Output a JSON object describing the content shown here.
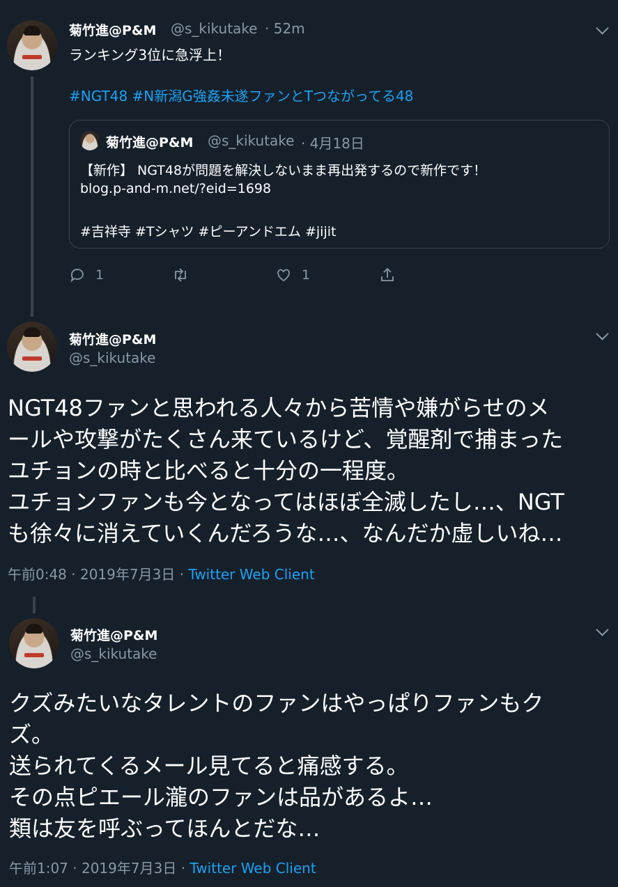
{
  "tweet1": {
    "author_name": "菊竹進@P&M",
    "author_handle": "@s_kikutake",
    "time": "· 52m",
    "text_line1": "ランキング3位に急浮上！",
    "hashtags": "#NGT48 #N新潟G強姦未遂ファンとTつながってる48",
    "quote": {
      "author_name": "菊竹進@P&M",
      "author_handle": "@s_kikutake",
      "time": "· 4月18日",
      "line1": "【新作】 NGT48が問題を解決しないまま再出発するので新作です！",
      "line2": "blog.p-and-m.net/?eid=1698",
      "line3": "#吉祥寺 #Tシャツ #ピーアンドエム #jijit"
    },
    "reply_count": "1",
    "like_count": "1"
  },
  "tweet2": {
    "author_name": "菊竹進@P&M",
    "author_handle": "@s_kikutake",
    "lines": [
      "NGT48ファンと思われる人々から苦情や嫌がらせのメ",
      "ールや攻撃がたくさん来ているけど、覚醒剤で捕まった",
      "ユチョンの時と比べると十分の一程度。",
      "ユチョンファンも今となってはほぼ全滅したし…、NGT",
      "も徐々に消えていくんだろうな…、なんだか虚しいね…"
    ],
    "meta_time": "午前0:48 · 2019年7月3日 · ",
    "meta_client": "Twitter Web Client"
  },
  "tweet3": {
    "author_name": "菊竹進@P&M",
    "author_handle": "@s_kikutake",
    "lines": [
      "クズみたいなタレントのファンはやっぱりファンもク",
      "ズ。",
      "送られてくるメール見てると痛感する。",
      "その点ピエール瀧のファンは品があるよ…",
      "類は友を呼ぶってほんとだな…"
    ],
    "meta_time": "午前1:07 · 2019年7月3日 · ",
    "meta_client": "Twitter Web Client"
  },
  "icons": {
    "reply": "reply-icon",
    "retweet": "retweet-icon",
    "like": "heart-icon",
    "share": "share-icon",
    "caret": "chevron-down-icon"
  },
  "colors": {
    "background": "#15202b",
    "muted": "#8899a6",
    "link": "#1da1f2",
    "border": "#38444d"
  }
}
